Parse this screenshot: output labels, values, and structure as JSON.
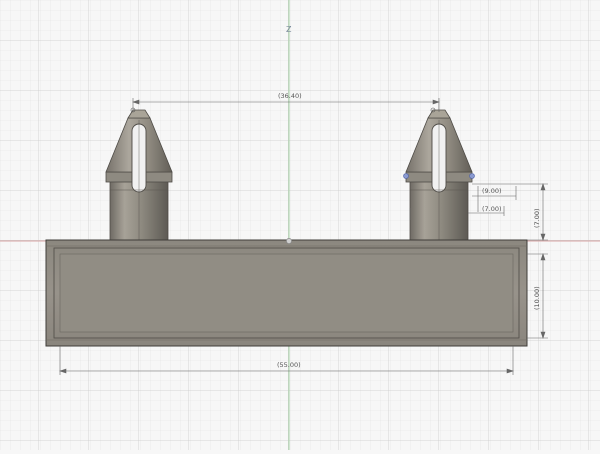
{
  "axis": {
    "z_label": "Z"
  },
  "dimensions": {
    "top_span": "(36.40)",
    "overall_length": "(55.00)",
    "base_height": "(10.00)",
    "peg_height": "(7.00)",
    "peg_top_width": "(9.00)",
    "peg_shaft_width": "(7.00)"
  },
  "colors": {
    "background": "#f7f7f7",
    "grid_minor": "#e3e3e3",
    "grid_major": "#cfcfcf",
    "axis_x": "#d9a0a0",
    "axis_z": "#9fd09f",
    "body": "#9a958c",
    "body_dark": "#5b5852",
    "dimension_line": "#666666"
  }
}
